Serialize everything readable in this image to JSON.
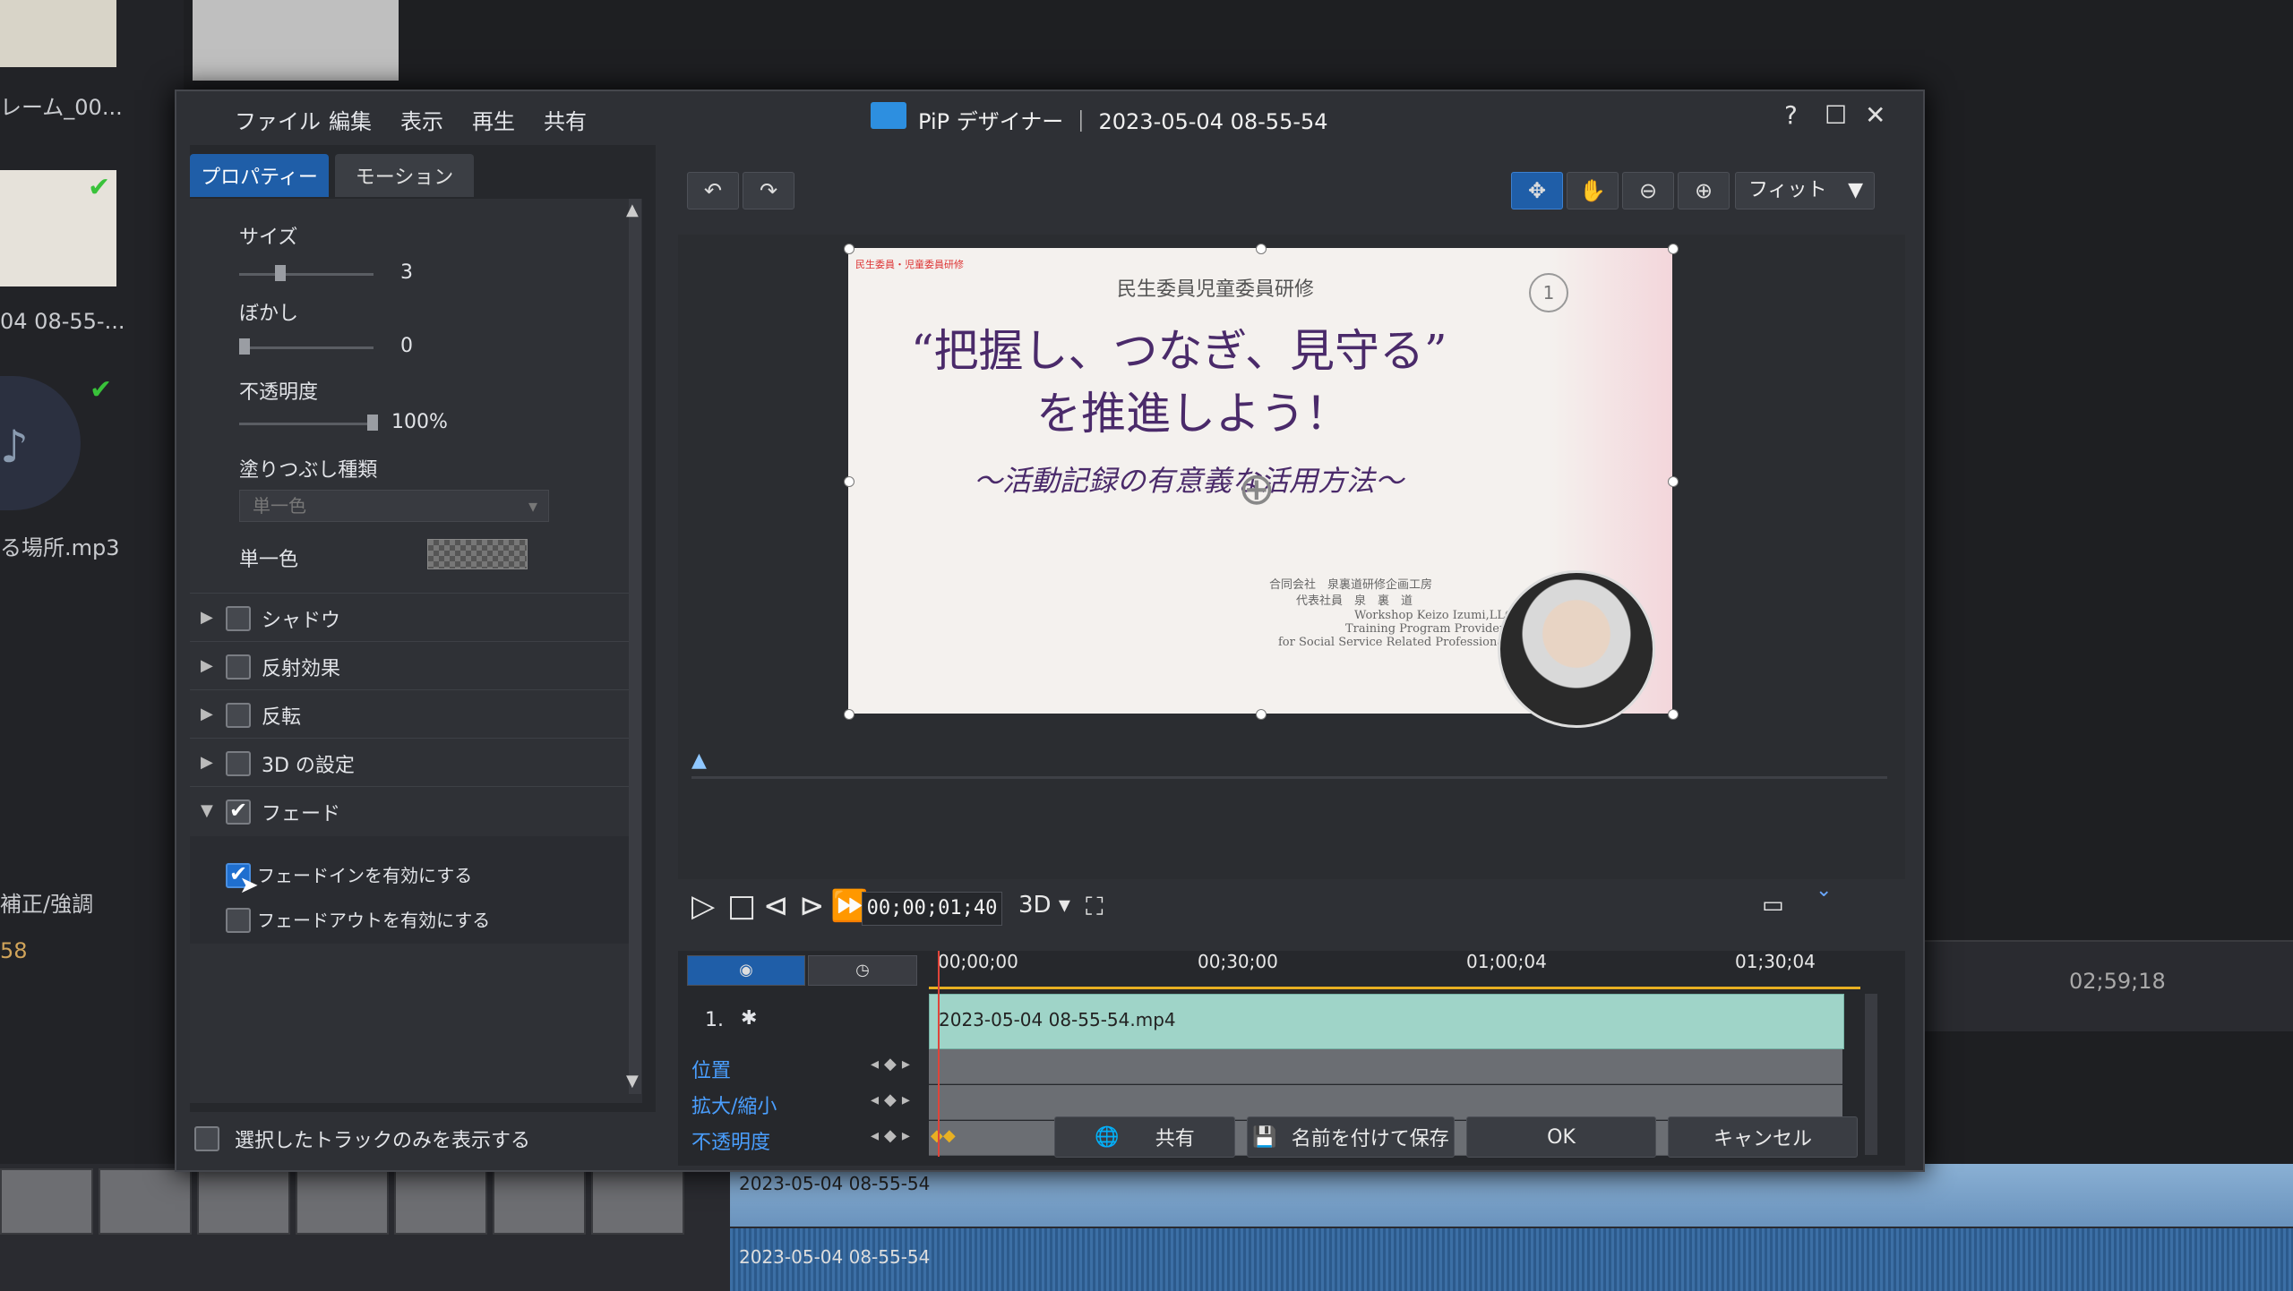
{
  "background": {
    "file_label_1": "レーム_00...",
    "file_label_2": "04 08-55-...",
    "file_label_3": "る場所.mp3",
    "correction_label": "補正/強調",
    "time_left": "58",
    "time_right": "02;59;18",
    "track_clip_1": "2023-05-04 08-55-54",
    "track_clip_2": "2023-05-04 08-55-54"
  },
  "dialog": {
    "title": "PiP デザイナー ｜ 2023-05-04 08-55-54",
    "menu": [
      "ファイル",
      "編集",
      "表示",
      "再生",
      "共有"
    ],
    "window_buttons": {
      "help": "?",
      "maximize": "☐",
      "close": "✕"
    }
  },
  "tabs": [
    {
      "label": "プロパティー",
      "active": true
    },
    {
      "label": "モーション",
      "active": false
    }
  ],
  "properties": {
    "size": {
      "label": "サイズ",
      "value": "3"
    },
    "blur": {
      "label": "ぼかし",
      "value": "0"
    },
    "opacity": {
      "label": "不透明度",
      "value": "100%"
    },
    "fill_type": {
      "label": "塗りつぶし種類",
      "value": "単一色"
    },
    "solid_color": {
      "label": "単一色"
    },
    "sections": [
      {
        "label": "シャドウ",
        "checked": false,
        "expanded": false
      },
      {
        "label": "反射効果",
        "checked": false,
        "expanded": false
      },
      {
        "label": "反転",
        "checked": false,
        "expanded": false
      },
      {
        "label": "3D の設定",
        "checked": false,
        "expanded": false
      },
      {
        "label": "フェード",
        "checked": true,
        "expanded": true
      }
    ],
    "fade_in": {
      "label": "フェードインを有効にする",
      "checked": true
    },
    "fade_out": {
      "label": "フェードアウトを有効にする",
      "checked": false
    },
    "show_selected_only": {
      "label": "選択したトラックのみを表示する",
      "checked": false
    }
  },
  "toolbar": {
    "undo": "↶",
    "redo": "↷",
    "fit_label": "フィット"
  },
  "slide": {
    "subtitle": "民生委員児童委員研修",
    "title_line1": "“把握し、つなぎ、見守る”",
    "title_line2": "を推進しよう！",
    "title_line3": "～活動記録の有意義な活用方法～",
    "page_number": "1",
    "corner_text": "民生委員・児童委員研修",
    "credit_1": "合同会社　泉裏道研修企画工房",
    "credit_2": "代表社員　泉　裏　道",
    "credit_3": "Workshop Keizo Izumi,LLC",
    "credit_4": "Training Program Provider",
    "credit_5": "for Social Service Related Professionals"
  },
  "transport": {
    "timecode": "00;00;01;40",
    "mode_3d": "3D"
  },
  "timeline": {
    "ruler_labels": [
      "00;00;00",
      "00;30;00",
      "01;00;04",
      "01;30;04"
    ],
    "track_number": "1.",
    "clip_name": "2023-05-04 08-55-54.mp4",
    "keyframe_rows": [
      "位置",
      "拡大/縮小",
      "不透明度"
    ]
  },
  "buttons": {
    "share": "共有",
    "save_as": "名前を付けて保存",
    "ok": "OK",
    "cancel": "キャンセル"
  },
  "colors": {
    "accent": "#1f5ea8",
    "timeline_clip": "#9fd4c8",
    "ruler": "#e8b022",
    "playhead": "#e0443a"
  }
}
